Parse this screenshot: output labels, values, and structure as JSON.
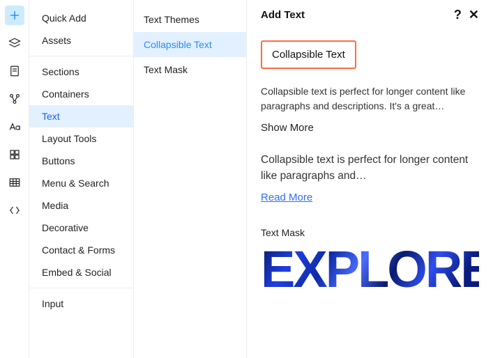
{
  "panel": {
    "title": "Add Text",
    "help": "?",
    "close": "✕"
  },
  "categories": {
    "group1": [
      {
        "label": "Quick Add"
      },
      {
        "label": "Assets"
      }
    ],
    "group2": [
      {
        "label": "Sections"
      },
      {
        "label": "Containers"
      },
      {
        "label": "Text",
        "selected": true
      },
      {
        "label": "Layout Tools"
      },
      {
        "label": "Buttons"
      },
      {
        "label": "Menu & Search"
      },
      {
        "label": "Media"
      },
      {
        "label": "Decorative"
      },
      {
        "label": "Contact & Forms"
      },
      {
        "label": "Embed & Social"
      }
    ],
    "group3": [
      {
        "label": "Input"
      }
    ]
  },
  "subcategories": [
    {
      "label": "Text Themes"
    },
    {
      "label": "Collapsible Text",
      "selected": true
    },
    {
      "label": "Text Mask"
    }
  ],
  "main": {
    "highlight": "Collapsible Text",
    "desc1": "Collapsible text is perfect for longer content like paragraphs and descriptions. It's a great…",
    "showMore": "Show More",
    "desc2": "Collapsible text is perfect for longer content like paragraphs and…",
    "readMore": "Read More",
    "maskLabel": "Text Mask",
    "exploreText": "EXPLORE"
  }
}
